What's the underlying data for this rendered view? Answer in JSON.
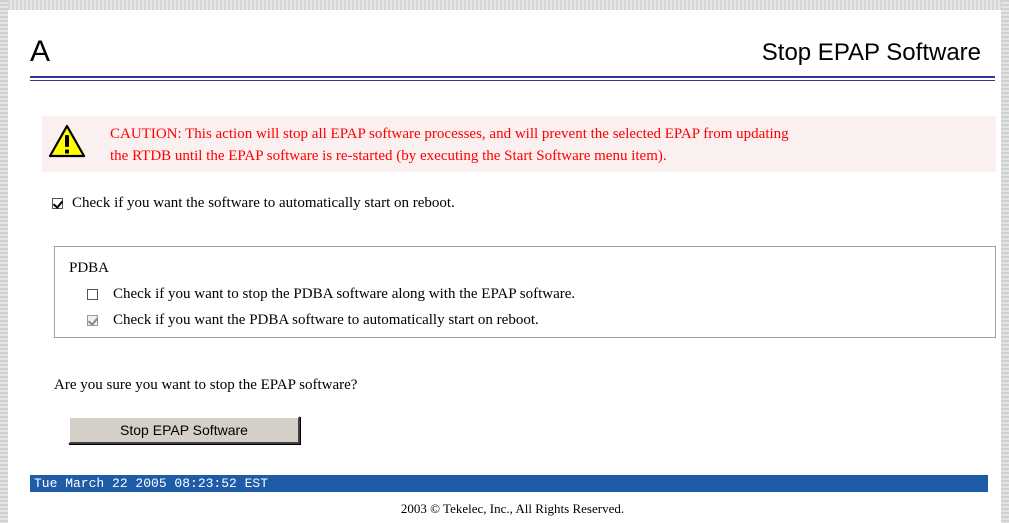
{
  "header": {
    "letter": "A",
    "title": "Stop EPAP Software"
  },
  "caution": {
    "icon": "warning-triangle-icon",
    "text_line1": "CAUTION: This action will stop all EPAP software processes, and will prevent the selected EPAP from updating",
    "text_line2": "the RTDB until the EPAP software is re-started (by executing the Start Software menu item).",
    "color": "#ff0000"
  },
  "auto_start": {
    "checked": true,
    "label": "Check if you want the software to automatically start on reboot."
  },
  "pdba": {
    "title": "PDBA",
    "stop_option": {
      "checked": false,
      "label": "Check if you want to stop the PDBA software along with the EPAP software."
    },
    "auto_start_option": {
      "checked": true,
      "disabled": true,
      "label": "Check if you want the PDBA software to automatically start on reboot."
    }
  },
  "confirm": {
    "question": "Are you sure you want to stop the EPAP software?",
    "button_label": "Stop EPAP Software"
  },
  "status_bar": {
    "datetime": "Tue March 22 2005 08:23:52 EST",
    "color": "#1f5ca8"
  },
  "footer": {
    "copyright": "2003 © Tekelec, Inc., All Rights Reserved."
  }
}
